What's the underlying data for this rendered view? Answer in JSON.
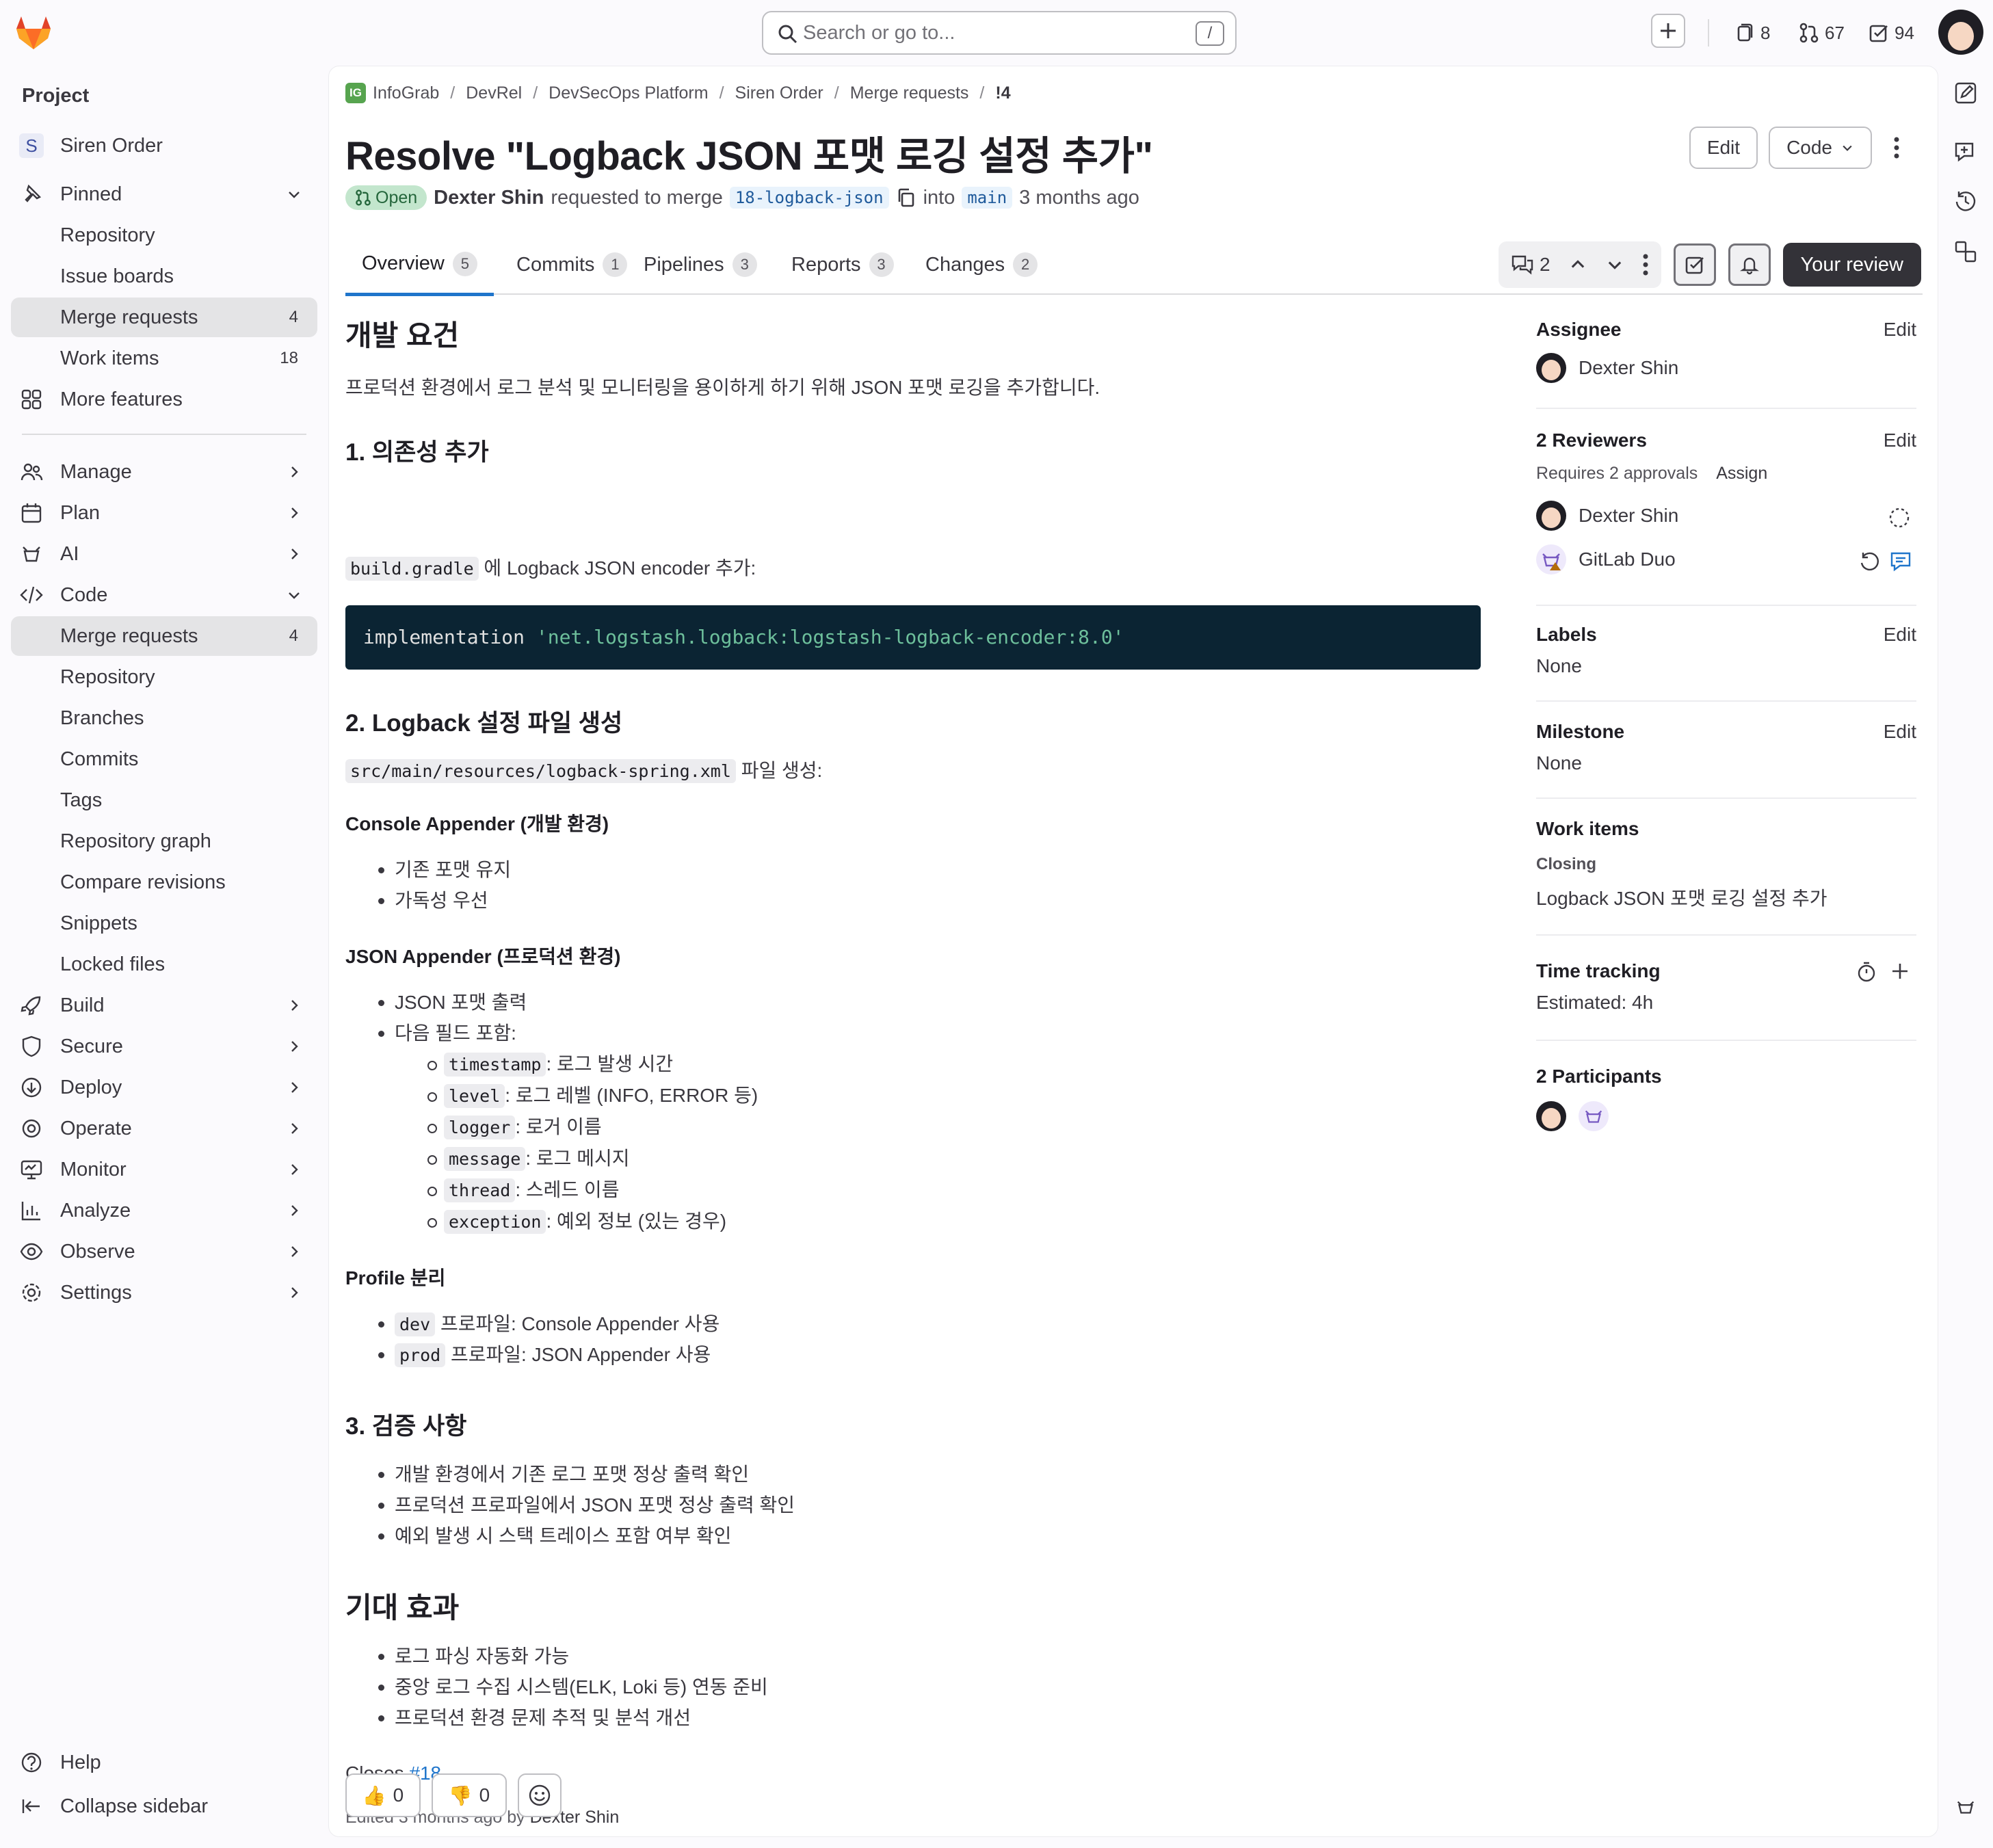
{
  "topbar": {
    "search_placeholder": "Search or go to...",
    "search_shortcut": "/",
    "issues_count": "8",
    "mrs_count": "67",
    "todos_count": "94"
  },
  "sidebar": {
    "section_title": "Project",
    "project_initial": "S",
    "project_name": "Siren Order",
    "pinned": "Pinned",
    "pinned_items": [
      {
        "label": "Repository",
        "count": ""
      },
      {
        "label": "Issue boards",
        "count": ""
      },
      {
        "label": "Merge requests",
        "count": "4"
      },
      {
        "label": "Work items",
        "count": "18"
      }
    ],
    "more_features": "More features",
    "groups": [
      "Manage",
      "Plan",
      "AI",
      "Code"
    ],
    "code_items": [
      {
        "label": "Merge requests",
        "count": "4"
      },
      {
        "label": "Repository",
        "count": ""
      },
      {
        "label": "Branches",
        "count": ""
      },
      {
        "label": "Commits",
        "count": ""
      },
      {
        "label": "Tags",
        "count": ""
      },
      {
        "label": "Repository graph",
        "count": ""
      },
      {
        "label": "Compare revisions",
        "count": ""
      },
      {
        "label": "Snippets",
        "count": ""
      },
      {
        "label": "Locked files",
        "count": ""
      }
    ],
    "lower_groups": [
      "Build",
      "Secure",
      "Deploy",
      "Operate",
      "Monitor",
      "Analyze",
      "Observe",
      "Settings"
    ],
    "help": "Help",
    "collapse": "Collapse sidebar"
  },
  "breadcrumb": {
    "items": [
      "InfoGrab",
      "DevRel",
      "DevSecOps Platform",
      "Siren Order",
      "Merge requests",
      "!4"
    ],
    "logo_text": "IG"
  },
  "mr": {
    "title": "Resolve \"Logback JSON 포맷 로깅 설정 추가\"",
    "edit_label": "Edit",
    "code_label": "Code",
    "status": "Open",
    "author": "Dexter Shin",
    "requested_text": "requested to merge",
    "source_branch": "18-logback-json",
    "into_text": "into",
    "target_branch": "main",
    "age": "3 months ago"
  },
  "tabs": [
    {
      "label": "Overview",
      "count": "5"
    },
    {
      "label": "Commits",
      "count": "1"
    },
    {
      "label": "Pipelines",
      "count": "3"
    },
    {
      "label": "Reports",
      "count": "3"
    },
    {
      "label": "Changes",
      "count": "2"
    }
  ],
  "review_tools": {
    "threads_count": "2",
    "your_review": "Your review"
  },
  "description": {
    "h_req": "개발 요건",
    "intro": "프로덕션 환경에서 로그 분석 및 모니터링을 용이하게 하기 위해 JSON 포맷 로깅을 추가합니다.",
    "h_dep": "1. 의존성 추가",
    "dep_file": "build.gradle",
    "dep_text": "에 Logback JSON encoder 추가:",
    "code_keyword": "implementation ",
    "code_string": "'net.logstash.logback:logstash-logback-encoder:8.0'",
    "h_conf": "2. Logback 설정 파일 생성",
    "conf_file": "src/main/resources/logback-spring.xml",
    "conf_text": "파일 생성:",
    "h_console": "Console Appender (개발 환경)",
    "console_items": [
      "기존 포맷 유지",
      "가독성 우선"
    ],
    "h_json": "JSON Appender (프로덕션 환경)",
    "json_items": [
      "JSON 포맷 출력",
      "다음 필드 포함:"
    ],
    "fields": [
      {
        "code": "timestamp",
        "text": ": 로그 발생 시간"
      },
      {
        "code": "level",
        "text": ": 로그 레벨 (INFO, ERROR 등)"
      },
      {
        "code": "logger",
        "text": ": 로거 이름"
      },
      {
        "code": "message",
        "text": ": 로그 메시지"
      },
      {
        "code": "thread",
        "text": ": 스레드 이름"
      },
      {
        "code": "exception",
        "text": ": 예외 정보 (있는 경우)"
      }
    ],
    "h_profile": "Profile 분리",
    "profiles": [
      {
        "code": "dev",
        "text": "프로파일: Console Appender 사용"
      },
      {
        "code": "prod",
        "text": "프로파일: JSON Appender 사용"
      }
    ],
    "h_verify": "3. 검증 사항",
    "verify_items": [
      "개발 환경에서 기존 로그 포맷 정상 출력 확인",
      "프로덕션 프로파일에서 JSON 포맷 정상 출력 확인",
      "예외 발생 시 스택 트레이스 포함 여부 확인"
    ],
    "h_effect": "기대 효과",
    "effect_items": [
      "로그 파싱 자동화 가능",
      "중앙 로그 수집 시스템(ELK, Loki 등) 연동 준비",
      "프로덕션 환경 문제 추적 및 분석 개선"
    ],
    "closes_text": "Closes",
    "closes_ref": "#18",
    "edited_text": "Edited 3 months ago by",
    "edited_by": "Dexter Shin",
    "thumbs_up": "0",
    "thumbs_down": "0"
  },
  "right": {
    "assignee_head": "Assignee",
    "edit": "Edit",
    "assignee": "Dexter Shin",
    "reviewers_head": "2 Reviewers",
    "requires": "Requires 2 approvals",
    "assign": "Assign",
    "reviewer1": "Dexter Shin",
    "reviewer2": "GitLab Duo",
    "labels_head": "Labels",
    "labels_value": "None",
    "milestone_head": "Milestone",
    "milestone_value": "None",
    "workitems_head": "Work items",
    "closing": "Closing",
    "workitem": "Logback JSON 포맷 로깅 설정 추가",
    "time_head": "Time tracking",
    "estimated": "Estimated: 4h",
    "participants_head": "2 Participants"
  }
}
